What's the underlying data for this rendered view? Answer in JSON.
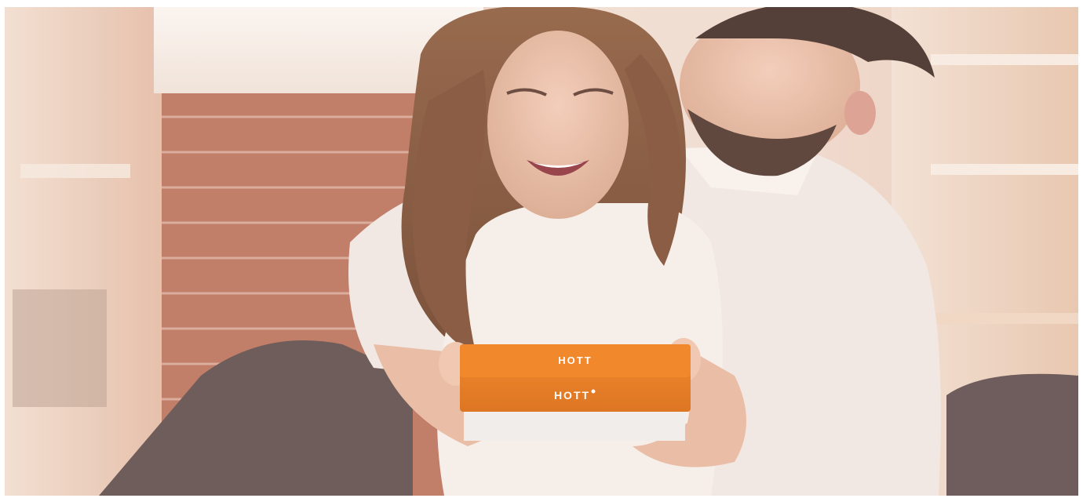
{
  "photo": {
    "subject": "couple-gift-surprise",
    "box_lid_logo": "HOTT",
    "box_front_logo": "HOTT",
    "colors": {
      "box_orange": "#e8730f",
      "box_white": "#eeeeee",
      "brick": "#b7674f",
      "wall": "#f3e4d8"
    }
  }
}
